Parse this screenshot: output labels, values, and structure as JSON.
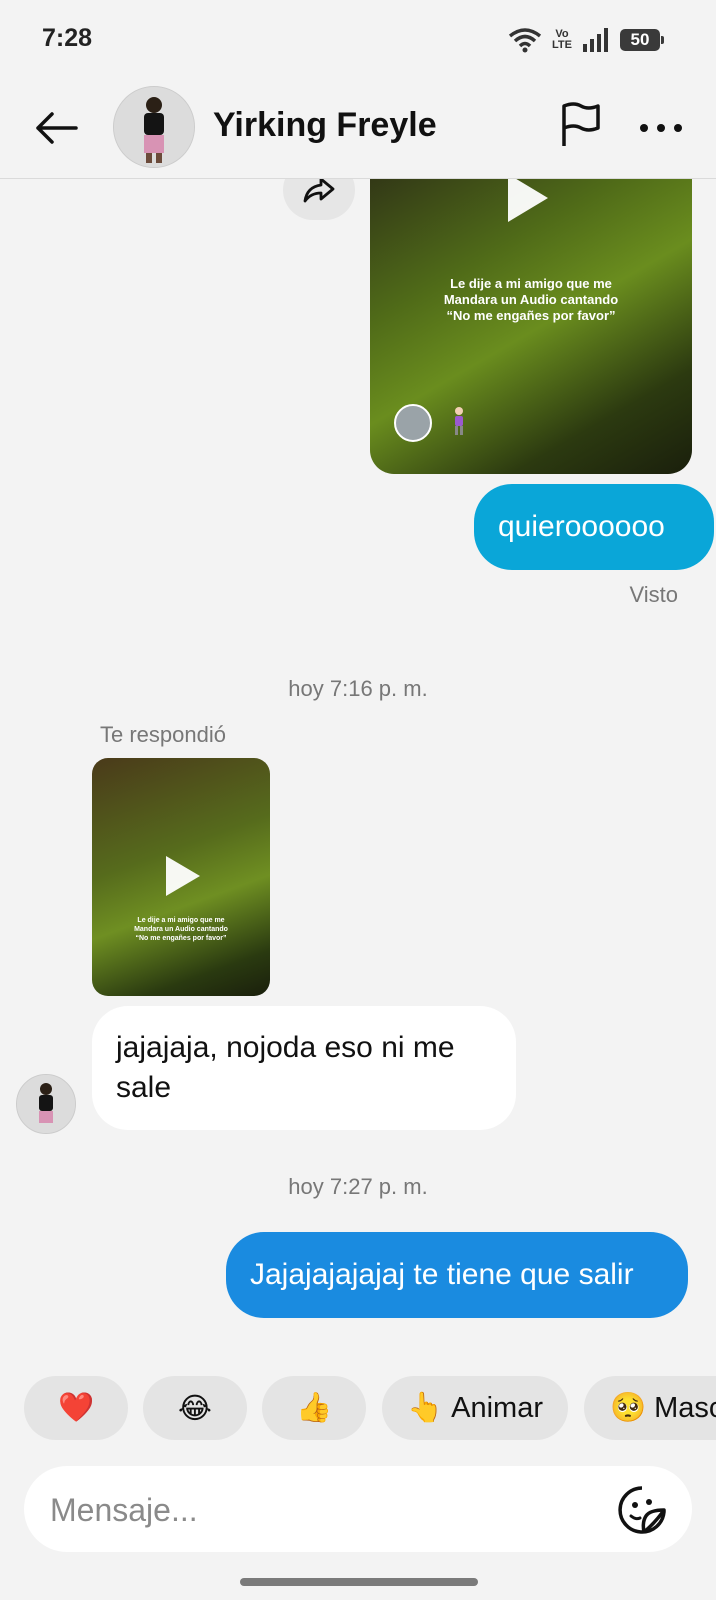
{
  "status_bar": {
    "time": "7:28",
    "network_label_top": "Vo",
    "network_label_bottom": "LTE",
    "battery": "50"
  },
  "header": {
    "contact_name": "Yirking Freyle"
  },
  "messages": {
    "top_video_caption": [
      "Le dije a mi amigo que me",
      "Mandara un Audio cantando",
      "“No me engañes por favor”"
    ],
    "out_1": "quieroooooo",
    "seen": "Visto",
    "timestamp_1": "hoy 7:16 p. m.",
    "replied_label": "Te respondió",
    "small_video_caption": [
      "Le dije a mi amigo que me",
      "Mandara un Audio cantando",
      "“No me engañes por favor”"
    ],
    "in_1": "jajajaja, nojoda eso ni me sale",
    "timestamp_2": "hoy 7:27 p. m.",
    "out_2": "Jajajajajajaj te tiene que salir"
  },
  "reactions": [
    {
      "emoji": "❤️",
      "label": ""
    },
    {
      "emoji": "😂",
      "label": ""
    },
    {
      "emoji": "👍",
      "label": ""
    },
    {
      "emoji": "👆",
      "label": "Animar"
    },
    {
      "emoji": "🥺",
      "label": "Masc"
    }
  ],
  "composer": {
    "placeholder": "Mensaje..."
  }
}
